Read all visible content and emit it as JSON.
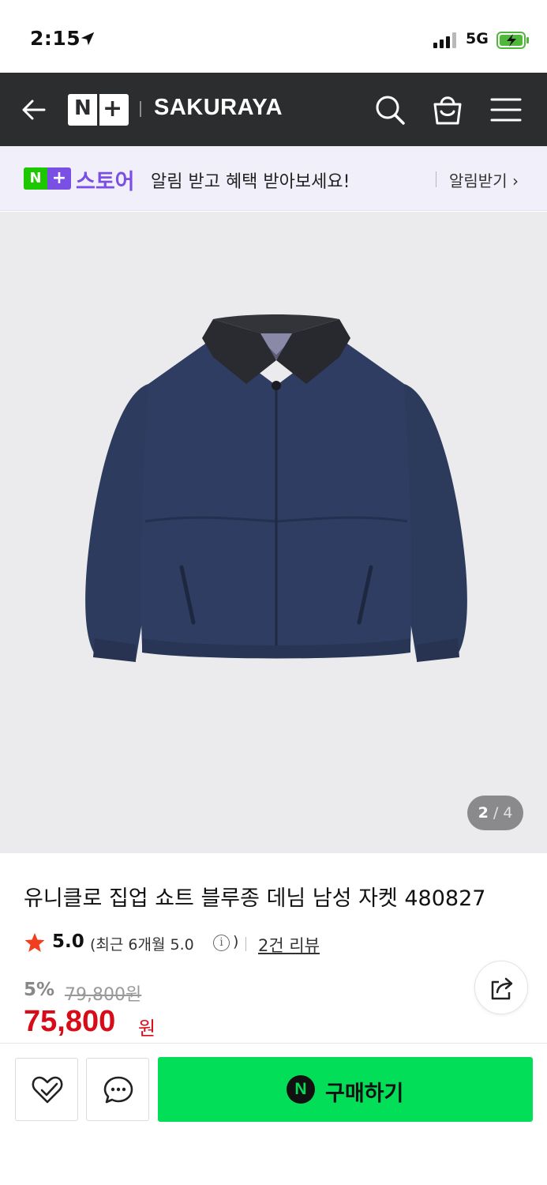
{
  "status_bar": {
    "time": "2:15",
    "network": "5G"
  },
  "header": {
    "logo_n": "N",
    "logo_plus": "+",
    "store_name": "SAKURAYA",
    "icons": [
      "back-arrow-icon",
      "search-icon",
      "shopping-bag-icon",
      "menu-icon"
    ]
  },
  "notice": {
    "badge_n": "N",
    "badge_plus": "+",
    "store_label": "스토어",
    "message": "알림 받고 혜택 받아보세요!",
    "action": "알림받기 ›"
  },
  "gallery": {
    "current": "2",
    "separator": "/",
    "total": "4"
  },
  "product": {
    "title": "유니클로 집업 쇼트 블루종 데님 남성 자켓 480827",
    "rating": "5.0",
    "recent_rating": "(최근 6개월 5.0",
    "info_symbol": "i",
    "recent_close": ")",
    "reviews": "2건 리뷰",
    "discount": "5%",
    "original_price": "79,800원",
    "sale_price": "75,800",
    "sale_unit": "원"
  },
  "bottom_bar": {
    "buy_badge": "N",
    "buy_label": "구매하기"
  },
  "colors": {
    "header_bg": "#2b2d2f",
    "notice_bg": "#f1eff9",
    "store_purple": "#7a4fe3",
    "naver_green": "#03de59",
    "price_red": "#d80c18",
    "star_red": "#f23d1e"
  }
}
